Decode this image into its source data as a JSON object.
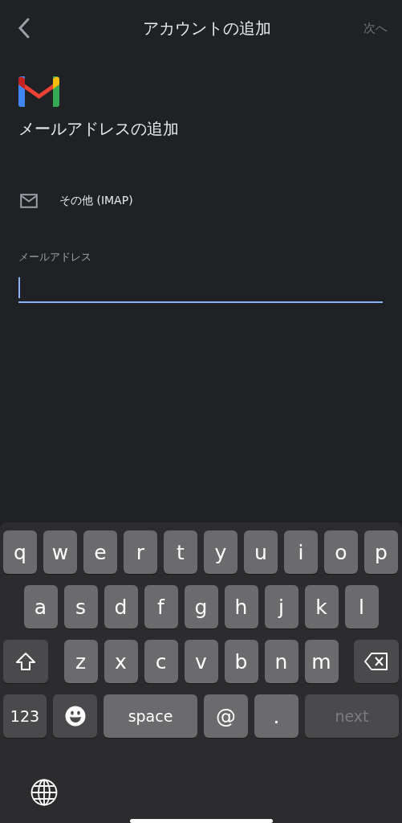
{
  "header": {
    "title": "アカウントの追加",
    "next": {
      "label": "次へ",
      "disabled": true
    }
  },
  "heading": "メールアドレスの追加",
  "provider": {
    "label": "その他 (IMAP)"
  },
  "email_field": {
    "label": "メールアドレス",
    "focused": true
  },
  "keyboard": {
    "rows": [
      {
        "keys": [
          {
            "kind": "char",
            "label": "q"
          },
          {
            "kind": "char",
            "label": "w"
          },
          {
            "kind": "char",
            "label": "e"
          },
          {
            "kind": "char",
            "label": "r"
          },
          {
            "kind": "char",
            "label": "t"
          },
          {
            "kind": "char",
            "label": "y"
          },
          {
            "kind": "char",
            "label": "u"
          },
          {
            "kind": "char",
            "label": "i"
          },
          {
            "kind": "char",
            "label": "o"
          },
          {
            "kind": "char",
            "label": "p"
          }
        ]
      },
      {
        "keys": [
          {
            "kind": "char",
            "label": "a"
          },
          {
            "kind": "char",
            "label": "s"
          },
          {
            "kind": "char",
            "label": "d"
          },
          {
            "kind": "char",
            "label": "f"
          },
          {
            "kind": "char",
            "label": "g"
          },
          {
            "kind": "char",
            "label": "h"
          },
          {
            "kind": "char",
            "label": "j"
          },
          {
            "kind": "char",
            "label": "k"
          },
          {
            "kind": "char",
            "label": "l"
          }
        ]
      },
      {
        "keys": [
          {
            "kind": "shift"
          },
          {
            "kind": "char",
            "label": "z"
          },
          {
            "kind": "char",
            "label": "x"
          },
          {
            "kind": "char",
            "label": "c"
          },
          {
            "kind": "char",
            "label": "v"
          },
          {
            "kind": "char",
            "label": "b"
          },
          {
            "kind": "char",
            "label": "n"
          },
          {
            "kind": "char",
            "label": "m"
          },
          {
            "kind": "delete"
          }
        ]
      },
      {
        "keys": [
          {
            "kind": "mode",
            "label": "123"
          },
          {
            "kind": "emoji"
          },
          {
            "kind": "space",
            "label": "space"
          },
          {
            "kind": "symbol",
            "label": "@"
          },
          {
            "kind": "symbol",
            "label": "."
          },
          {
            "kind": "return",
            "label": "next",
            "disabled": true
          }
        ]
      }
    ]
  }
}
